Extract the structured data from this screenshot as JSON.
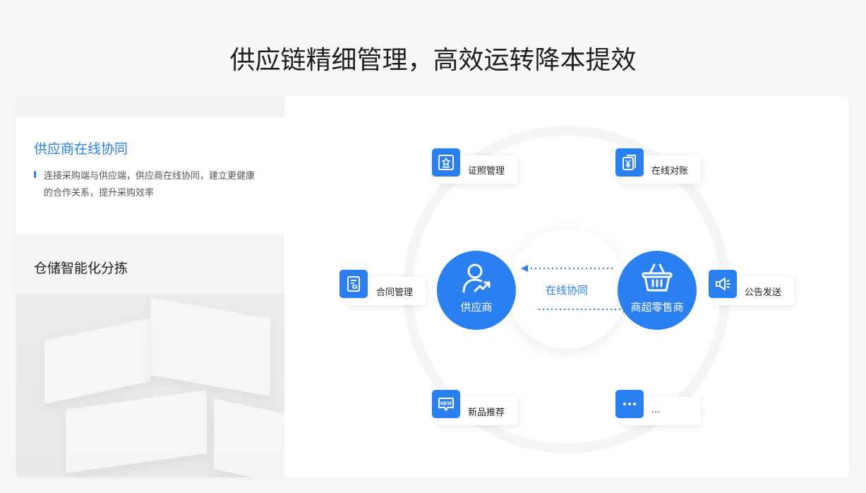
{
  "page": {
    "title": "供应链精细管理，高效运转降本提效"
  },
  "sidebar": {
    "items": [
      {
        "title": "供应商在线协同",
        "description": "连接采购端与供应端，供应商在线协同，建立更健康的合作关系，提升采购效率",
        "active": true
      },
      {
        "title": "仓储智能化分拣",
        "active": false
      }
    ]
  },
  "diagram": {
    "center_label": "在线协同",
    "left_node": {
      "label": "供应商",
      "icon": "user-trend-icon"
    },
    "right_node": {
      "label": "商超零售商",
      "icon": "basket-icon"
    },
    "features": [
      {
        "label": "证照管理",
        "icon": "certificate-icon"
      },
      {
        "label": "在线对账",
        "icon": "yen-document-icon"
      },
      {
        "label": "合同管理",
        "icon": "contract-icon"
      },
      {
        "label": "公告发送",
        "icon": "megaphone-icon"
      },
      {
        "label": "新品推荐",
        "icon": "new-badge-icon"
      },
      {
        "label": "...",
        "icon": "more-icon"
      }
    ]
  },
  "colors": {
    "accent": "#2a80f0",
    "page_background": "#f6f7f9",
    "text": "#222222"
  }
}
